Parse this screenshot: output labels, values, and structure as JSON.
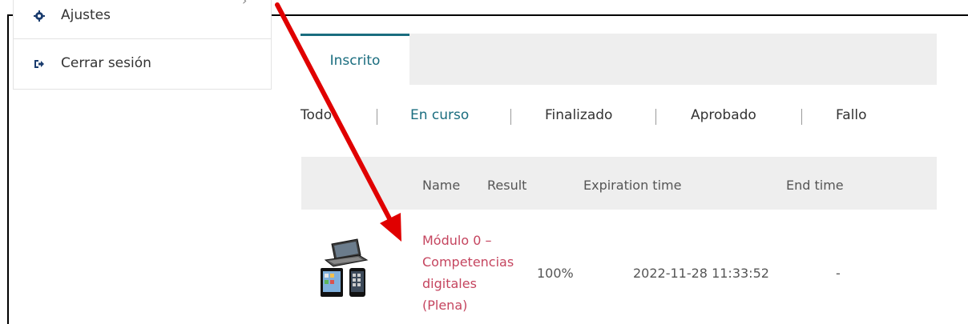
{
  "sidebar": {
    "items": [
      {
        "label": "Ajustes",
        "icon": "gear-icon",
        "chevron": "›"
      },
      {
        "label": "Cerrar sesión",
        "icon": "sign-out-icon"
      }
    ]
  },
  "tabs": [
    {
      "label": "Inscrito",
      "active": true
    }
  ],
  "filters": [
    {
      "label": "Todo"
    },
    {
      "label": "En curso",
      "active": true
    },
    {
      "label": "Finalizado"
    },
    {
      "label": "Aprobado"
    },
    {
      "label": "Fallo"
    }
  ],
  "table": {
    "columns": [
      "Name",
      "Result",
      "Expiration time",
      "End time"
    ],
    "rows": [
      {
        "image": "devices-icon",
        "name": "Módulo 0 –\nCompetencias\ndigitales\n(Plena)",
        "result": "100%",
        "expiration": "2022-11-28 11:33:52",
        "end": "-"
      }
    ]
  },
  "colors": {
    "accent": "#1a6d7f",
    "link": "#c5455f",
    "annotation_arrow": "#e00000",
    "header_bg": "#eeeeee"
  },
  "annotation": {
    "type": "arrow",
    "pointing_to": "course-link"
  }
}
